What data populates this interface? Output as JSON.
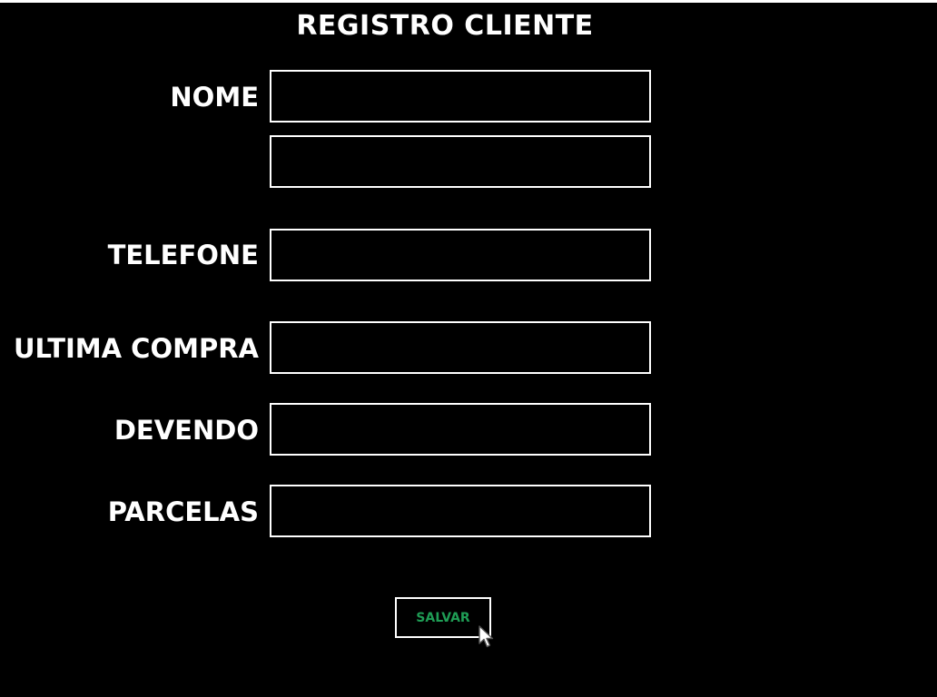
{
  "form": {
    "title": "REGISTRO CLIENTE",
    "fields": [
      {
        "label": "NOME",
        "value": "",
        "placeholder": ""
      },
      {
        "label": "",
        "value": "",
        "placeholder": ""
      },
      {
        "label": "TELEFONE",
        "value": "",
        "placeholder": ""
      },
      {
        "label": "ULTIMA COMPRA",
        "value": "",
        "placeholder": ""
      },
      {
        "label": "DEVENDO",
        "value": "",
        "placeholder": ""
      },
      {
        "label": "PARCELAS",
        "value": "",
        "placeholder": ""
      }
    ],
    "save_label": "SALVAR"
  },
  "colors": {
    "background": "#000000",
    "text": "#ffffff",
    "field_border": "#ffffff",
    "save_text": "#1f9d55"
  },
  "icons": {
    "cursor": "mouse-pointer-icon"
  }
}
